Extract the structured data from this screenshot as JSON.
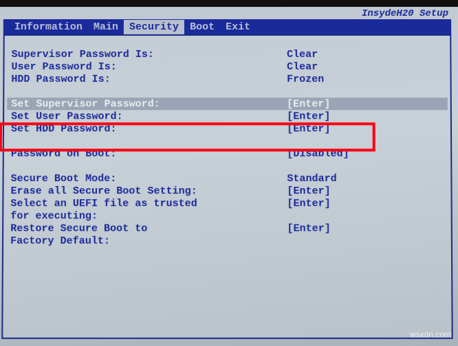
{
  "brand": "InsydeH20 Setup",
  "tabs": {
    "t0": "Information",
    "t1": "Main",
    "t2": "Security",
    "t3": "Boot",
    "t4": "Exit"
  },
  "rows": {
    "supervisor_pw_is": {
      "label": "Supervisor Password Is:",
      "value": "Clear"
    },
    "user_pw_is": {
      "label": "User Password Is:",
      "value": "Clear"
    },
    "hdd_pw_is": {
      "label": "HDD Password Is:",
      "value": "Frozen"
    },
    "set_supervisor": {
      "label": "Set Supervisor Password:",
      "value": "[Enter]"
    },
    "set_user": {
      "label": "Set User Password:",
      "value": "[Enter]"
    },
    "set_hdd": {
      "label": "Set HDD Password:",
      "value": "[Enter]"
    },
    "pw_on_boot": {
      "label": "Password on Boot:",
      "value": "[Disabled]"
    },
    "secure_mode": {
      "label": "Secure Boot Mode:",
      "value": "Standard"
    },
    "erase_secure": {
      "label": "Erase all Secure Boot Setting:",
      "value": "[Enter]"
    },
    "select_uefi": {
      "label": "Select an UEFI file as trusted",
      "value": "[Enter]"
    },
    "select_uefi2": {
      "label": "for executing:",
      "value": ""
    },
    "restore_secure": {
      "label": "Restore Secure Boot to",
      "value": "[Enter]"
    },
    "restore_secure2": {
      "label": "Factory Default:",
      "value": ""
    }
  },
  "watermark": "wsxdn.com"
}
